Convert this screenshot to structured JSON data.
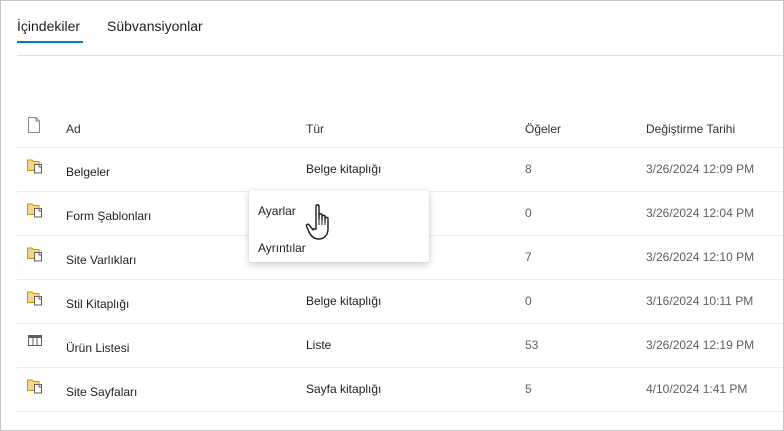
{
  "tabs": [
    {
      "label": "İçindekiler",
      "active": true
    },
    {
      "label": "Sübvansiyonlar",
      "active": false
    }
  ],
  "table": {
    "headers": {
      "icon": "file-icon",
      "name": "Ad",
      "type": "Tür",
      "items": "Öğeler",
      "modified": "Değiştirme Tarihi"
    },
    "rows": [
      {
        "icon": "library-icon",
        "name": "Belgeler",
        "type": "Belge kitaplığı",
        "items": "8",
        "modified": "3/26/2024 12:09 PM"
      },
      {
        "icon": "library-icon",
        "name": "Form Şablonları",
        "type": "",
        "items": "0",
        "modified": "3/26/2024 12:04 PM"
      },
      {
        "icon": "library-icon",
        "name": "Site Varlıkları",
        "type": "",
        "items": "7",
        "modified": "3/26/2024 12:10 PM"
      },
      {
        "icon": "library-icon",
        "name": "Stil Kitaplığı",
        "type": "Belge kitaplığı",
        "items": "0",
        "modified": "3/16/2024 10:11 PM"
      },
      {
        "icon": "list-icon",
        "name": "Ürün Listesi",
        "type": "Liste",
        "items": "53",
        "modified": "3/26/2024 12:19 PM"
      },
      {
        "icon": "library-icon",
        "name": "Site Sayfaları",
        "type": "Sayfa kitaplığı",
        "items": "5",
        "modified": "4/10/2024 1:41 PM"
      }
    ]
  },
  "context_menu": {
    "items": [
      {
        "label": "Ayarlar"
      },
      {
        "label": "Ayrıntılar"
      }
    ]
  },
  "colors": {
    "accent": "#0078d4",
    "library_icon": "#c19c00"
  }
}
